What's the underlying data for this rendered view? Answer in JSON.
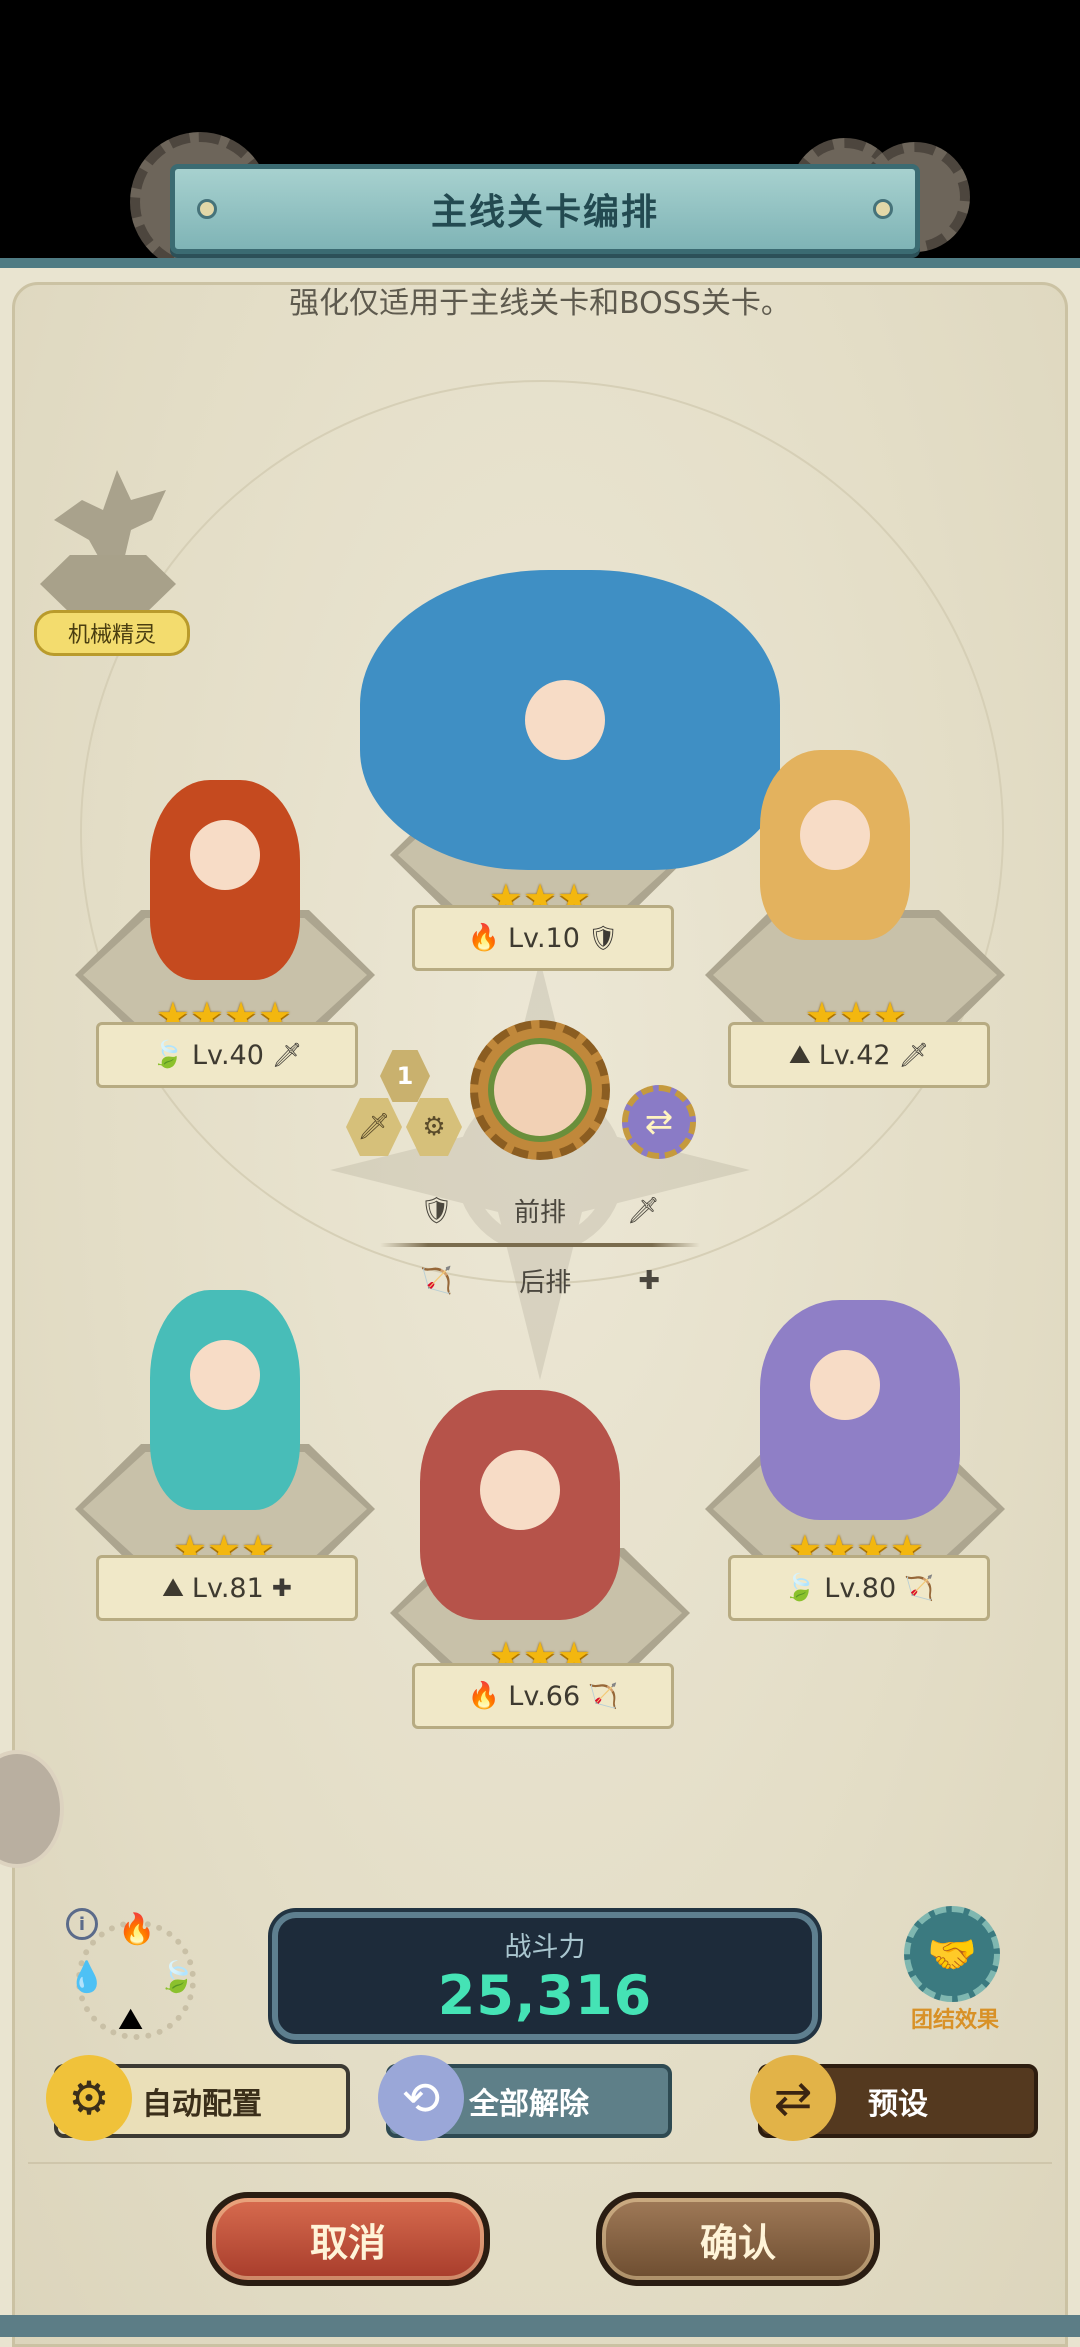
{
  "title": "主线关卡编排",
  "subtitle": "强化仅适用于主线关卡和BOSS关卡。",
  "mech_spirit": "机械精灵",
  "heroes": [
    {
      "stars": "★★★★",
      "element": "🍃",
      "level": "Lv.40",
      "role": "🗡"
    },
    {
      "stars": "★★★",
      "element": "🔥",
      "level": "Lv.10",
      "role": "🛡"
    },
    {
      "stars": "★★★",
      "element": "⛰",
      "level": "Lv.42",
      "role": "🗡"
    },
    {
      "stars": "★★★",
      "element": "⛰",
      "level": "Lv.81",
      "role": "✚"
    },
    {
      "stars": "★★★",
      "element": "🔥",
      "level": "Lv.66",
      "role": "🏹"
    },
    {
      "stars": "★★★★",
      "element": "🍃",
      "level": "Lv.80",
      "role": "🏹"
    }
  ],
  "leader": {
    "slot_number": "1"
  },
  "legend": {
    "front": "前排",
    "back": "后排"
  },
  "power": {
    "label": "战斗力",
    "value": "25,316"
  },
  "unity_label": "团结效果",
  "buttons": {
    "auto": "自动配置",
    "clear": "全部解除",
    "preset": "预设",
    "cancel": "取消",
    "confirm": "确认"
  },
  "colors": {
    "panel": "#e9e4d0",
    "frame": "#4f7b83",
    "power_value": "#45e3b5",
    "star": "#f3b70f"
  }
}
